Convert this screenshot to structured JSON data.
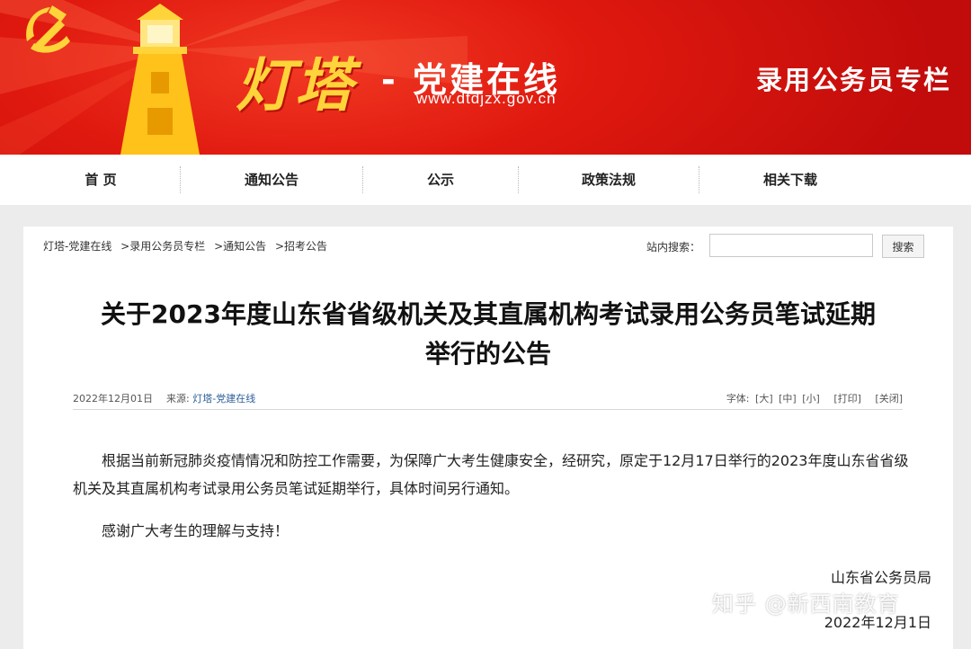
{
  "banner": {
    "brand_name": "灯塔",
    "brand_sub": "- 党建在线",
    "url": "www.dtdjzx.gov.cn",
    "column_title": "录用公务员专栏"
  },
  "nav": {
    "items": [
      "首 页",
      "通知公告",
      "公示",
      "政策法规",
      "相关下载"
    ]
  },
  "breadcrumb": [
    "灯塔-党建在线",
    ">录用公务员专栏",
    ">通知公告",
    ">招考公告"
  ],
  "search": {
    "label": "站内搜索：",
    "placeholder": "",
    "button": "搜索"
  },
  "article": {
    "title_line1": "关于2023年度山东省省级机关及其直属机构考试录用公务员笔试延期",
    "title_line2": "举行的公告",
    "date": "2022年12月01日",
    "source_label": "来源:",
    "source": "灯塔-党建在线",
    "font_label": "字体:",
    "font_large": "[大]",
    "font_medium": "[中]",
    "font_small": "[小]",
    "print": "[打印]",
    "close": "[关闭]",
    "para1_line1": "根据当前新冠肺炎疫情情况和防控工作需要，为保障广大考生健康安全，经研究，原定于12月17日举行的2023年度山东省省级",
    "para1_line2": "机关及其直属机构考试录用公务员笔试延期举行，具体时间另行通知。",
    "para2": "感谢广大考生的理解与支持！",
    "signature": "山东省公务员局",
    "sign_date": "2022年12月1日"
  },
  "watermark": "知乎 @新西南教育",
  "colors": {
    "banner_red": "#e0190f",
    "brand_yellow": "#ffd43a",
    "link_blue": "#2e5f9a"
  }
}
